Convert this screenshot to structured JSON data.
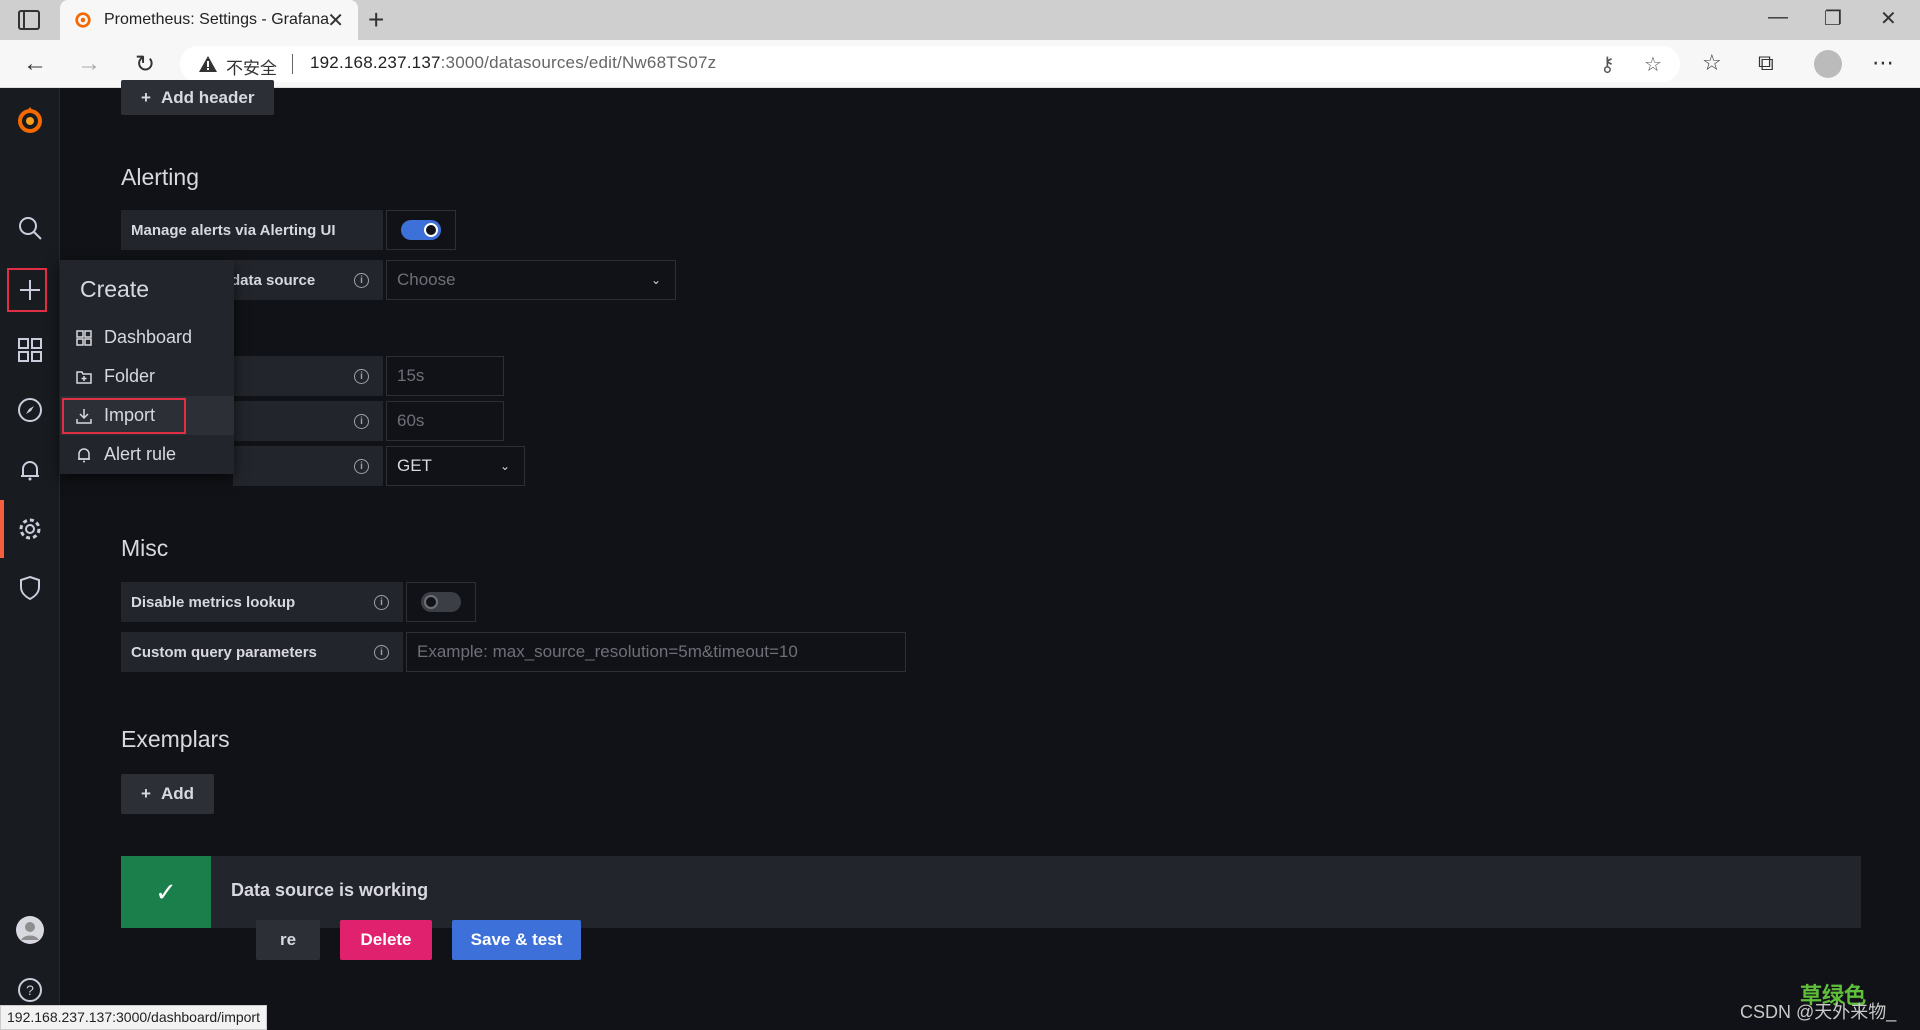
{
  "browser": {
    "tab_title": "Prometheus: Settings - Grafana",
    "insecure_label": "不安全",
    "url_host": "192.168.237.137",
    "url_rest": ":3000/datasources/edit/Nw68TS07z",
    "status_link": "192.168.237.137:3000/dashboard/import"
  },
  "flyout": {
    "title": "Create",
    "items": [
      "Dashboard",
      "Folder",
      "Import",
      "Alert rule"
    ]
  },
  "http": {
    "add_header_label": "Add header"
  },
  "alerting": {
    "heading": "Alerting",
    "manage_label": "Manage alerts via Alerting UI",
    "manage_enabled": true,
    "ds_label_partial": "data source",
    "ds_placeholder": "Choose"
  },
  "query": {
    "scrape_placeholder": "15s",
    "timeout_placeholder": "60s",
    "method_value": "GET"
  },
  "misc": {
    "heading": "Misc",
    "disable_metrics_label": "Disable metrics lookup",
    "disable_metrics_enabled": false,
    "custom_params_label": "Custom query parameters",
    "custom_params_placeholder": "Example: max_source_resolution=5m&timeout=10"
  },
  "exemplars": {
    "heading": "Exemplars",
    "add_label": "Add"
  },
  "status": {
    "message": "Data source is working"
  },
  "footer": {
    "back_partial": "re",
    "delete_label": "Delete",
    "save_label": "Save & test"
  },
  "watermark": {
    "text": "CSDN @天外来物_",
    "cn_logo": "草绿色"
  },
  "colors": {
    "grafana_orange": "#f55f3e",
    "primary_blue": "#3d71d9",
    "danger_pink": "#e0226e",
    "success_green": "#1a7f4b",
    "highlight_red": "#e02f44"
  }
}
